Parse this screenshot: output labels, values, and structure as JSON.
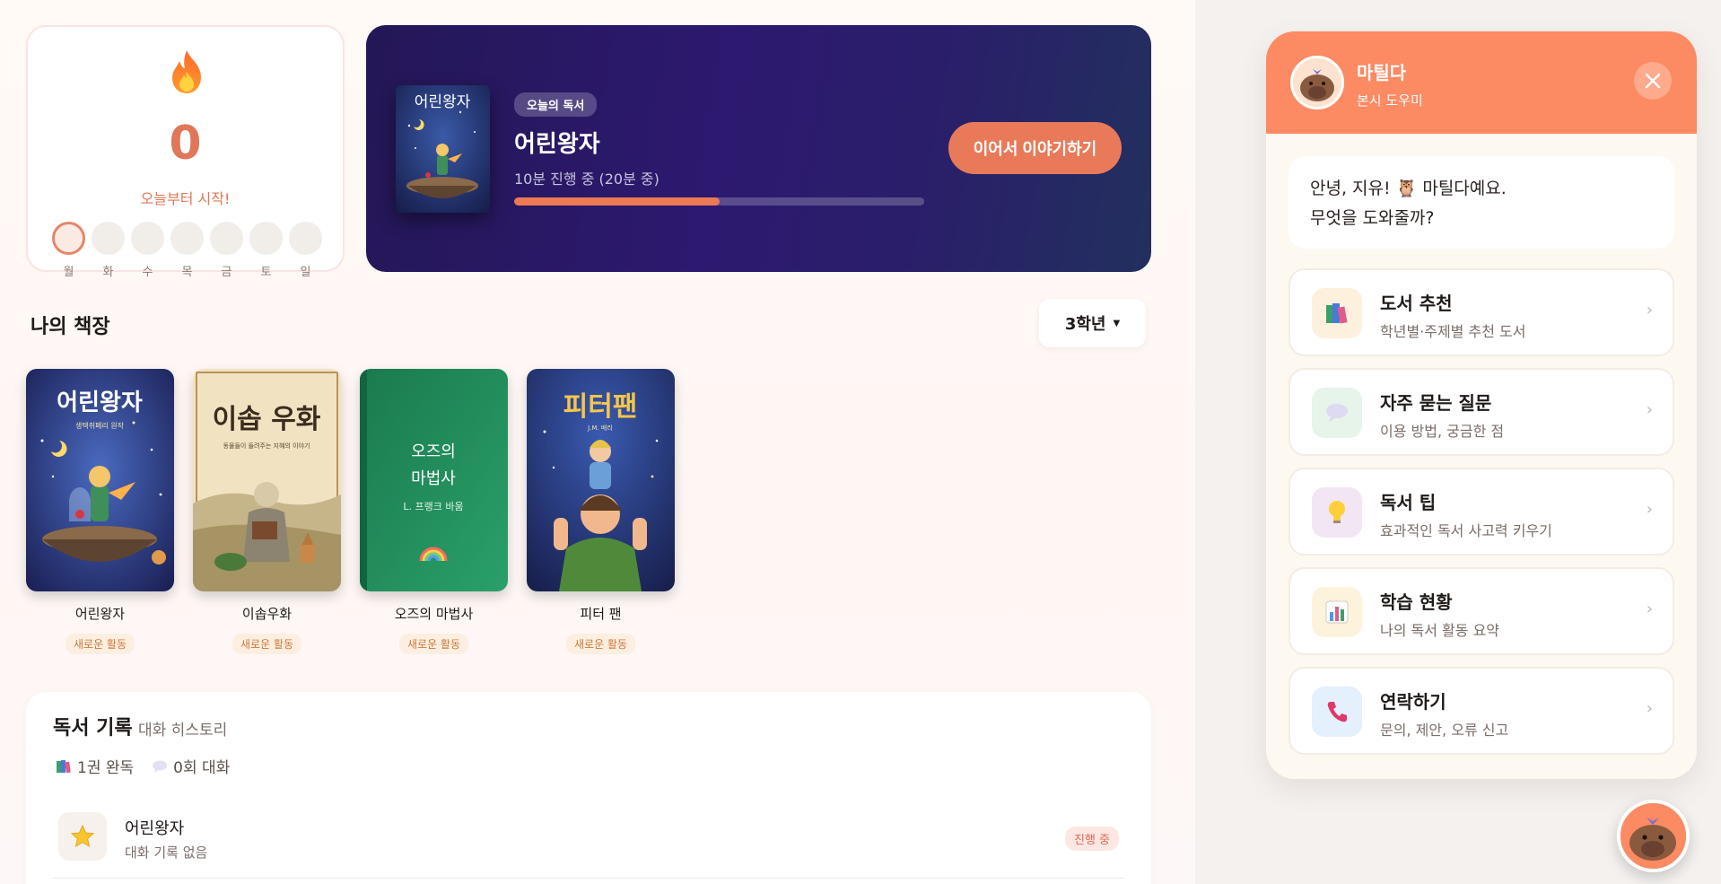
{
  "streak": {
    "count": "0",
    "message": "오늘부터 시작!",
    "days": [
      "월",
      "화",
      "수",
      "목",
      "금",
      "토",
      "일"
    ],
    "active_day_index": 0
  },
  "today": {
    "badge": "오늘의 독서",
    "title": "어린왕자",
    "progress_text": "10분 진행 중 (20분 중)",
    "progress_fraction": 0.5,
    "continue_button": "이어서 이야기하기",
    "cover_title": "어린왕자"
  },
  "shelf": {
    "title": "나의 책장",
    "grade_selected": "3학년",
    "books": [
      {
        "title": "어린왕자",
        "tag": "새로운 활동",
        "cover_title": "어린왕자",
        "cover_subtitle": "생텍쥐페리 원작"
      },
      {
        "title": "이솝우화",
        "tag": "새로운 활동",
        "cover_title": "이솝 우화",
        "cover_subtitle": "동물들이 들려주는 지혜의 이야기"
      },
      {
        "title": "오즈의 마법사",
        "tag": "새로운 활동",
        "cover_title_line1": "오즈의",
        "cover_title_line2": "마법사",
        "cover_subtitle": "L. 프랭크 바움"
      },
      {
        "title": "피터 팬",
        "tag": "새로운 활동",
        "cover_title": "피터팬",
        "cover_subtitle": "J.M. 배리"
      }
    ]
  },
  "log": {
    "title": "독서 기록",
    "subtitle": "대화 히스토리",
    "stats": {
      "completed": "1권 완독",
      "conversations": "0회 대화"
    },
    "items": [
      {
        "name": "어린왕자",
        "desc": "대화 기록 없음",
        "status": "진행 중"
      }
    ]
  },
  "chat": {
    "name": "마틸다",
    "role": "본시 도우미",
    "greeting_line1": "안녕, 지유! 🦉 마틸다예요.",
    "greeting_line2": "무엇을 도와줄까?",
    "menu": [
      {
        "title": "도서 추천",
        "desc": "학년별·주제별 추천 도서",
        "icon": "books-icon",
        "bg": "#fdf0dc"
      },
      {
        "title": "자주 묻는 질문",
        "desc": "이용 방법, 궁금한 점",
        "icon": "speech-bubble-icon",
        "bg": "#e6f4ea"
      },
      {
        "title": "독서 팁",
        "desc": "효과적인 독서 사고력 키우기",
        "icon": "lightbulb-icon",
        "bg": "#f3e6f4"
      },
      {
        "title": "학습 현황",
        "desc": "나의 독서 활동 요약",
        "icon": "bar-chart-icon",
        "bg": "#fdf3dc"
      },
      {
        "title": "연락하기",
        "desc": "문의, 제안, 오류 신고",
        "icon": "phone-icon",
        "bg": "#e4f0fb"
      }
    ]
  },
  "colors": {
    "accent": "#fc8a62",
    "hero_bg": "#2d1970",
    "button": "#e97a59"
  }
}
